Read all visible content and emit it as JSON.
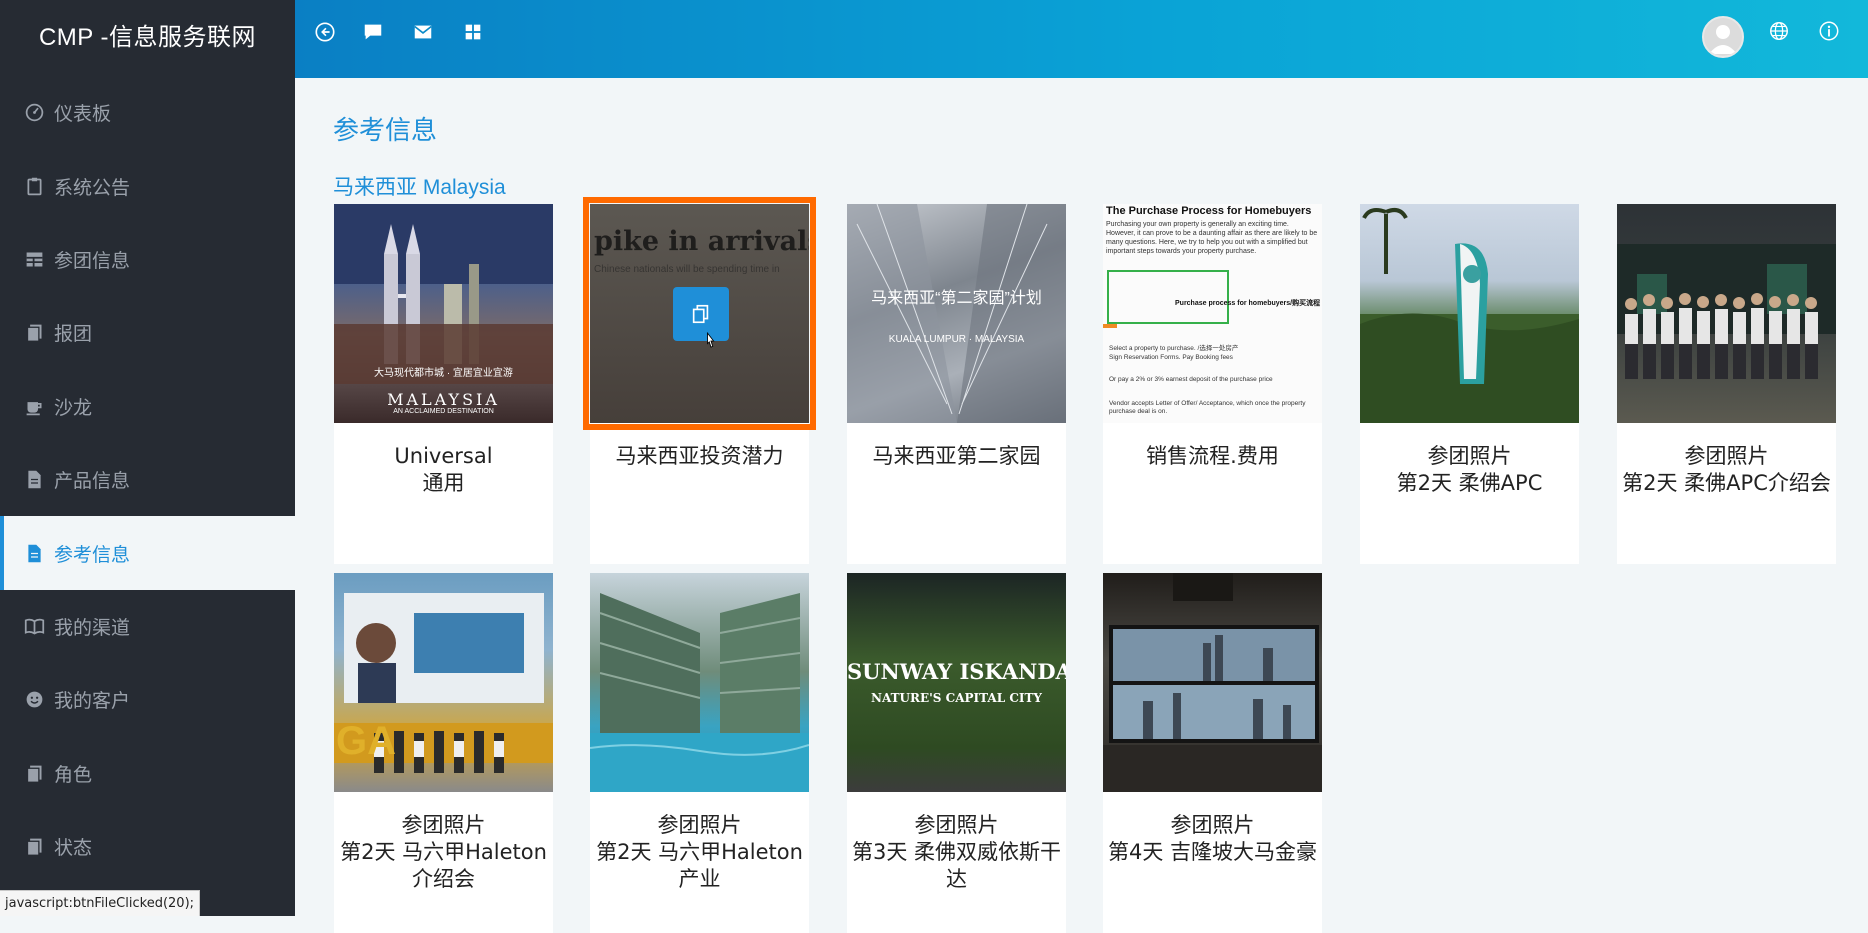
{
  "app": {
    "brand": "CMP -信息服务联网"
  },
  "sidebar": {
    "items": [
      {
        "label": "仪表板",
        "icon": "dashboard-icon"
      },
      {
        "label": "系统公告",
        "icon": "clipboard-icon"
      },
      {
        "label": "参团信息",
        "icon": "table-icon"
      },
      {
        "label": "报团",
        "icon": "documents-icon"
      },
      {
        "label": "沙龙",
        "icon": "coffee-icon"
      },
      {
        "label": "产品信息",
        "icon": "file-icon"
      },
      {
        "label": "参考信息",
        "icon": "file-icon",
        "active": true
      },
      {
        "label": "我的渠道",
        "icon": "book-icon"
      },
      {
        "label": "我的客户",
        "icon": "smile-icon"
      },
      {
        "label": "角色",
        "icon": "documents-icon"
      },
      {
        "label": "状态",
        "icon": "documents-icon"
      }
    ]
  },
  "header": {
    "icons": [
      "back-icon",
      "chat-icon",
      "mail-icon",
      "grid-icon",
      "avatar",
      "globe-icon",
      "info-icon"
    ]
  },
  "main": {
    "page_title": "参考信息",
    "section_title": "马来西亚 Malaysia",
    "cards": [
      {
        "lines": [
          "Universal",
          "通用"
        ],
        "thumb_text": [
          "大马现代都市城 · 宜居宜业宜游",
          "MALAYSIA",
          "AN ACCLAIMED DESTINATION"
        ]
      },
      {
        "lines": [
          "马来西亚投资潜力"
        ],
        "selected": true,
        "thumb_text": [
          "pike in arrivals fro",
          "Chinese nationals will be spending time in"
        ]
      },
      {
        "lines": [
          "马来西亚第二家园"
        ],
        "thumb_text": [
          "马来西亚“第二家园”计划",
          "KUALA LUMPUR · MALAYSIA"
        ]
      },
      {
        "lines": [
          "销售流程.费用"
        ],
        "thumb_text": [
          "The Purchase Process for Homebuyers",
          "Purchasing your own property is generally an exciting time. However, it can prove to be a daunting affair as there are likely to be many questions. Here, we try to help you out with a simplified but important steps towards your property purchase.",
          "Purchase process for homebuyers/购买流程",
          "Select a property to purchase. /选择一处房产",
          "Sign Reservation Forms. Pay Booking fees",
          "Or pay a 2% or 3% earnest deposit of the purchase price",
          "Vendor accepts Letter of Offer/ Acceptance, which once the property purchase deal is on."
        ]
      },
      {
        "lines": [
          "参团照片",
          "第2天 柔佛APC"
        ],
        "thumb_text": []
      },
      {
        "lines": [
          "参团照片",
          "第2天 柔佛APC介绍会"
        ],
        "thumb_text": []
      },
      {
        "lines": [
          "参团照片",
          "第2天 马六甲Haleton",
          "介绍会"
        ],
        "thumb_text": [
          "GA"
        ]
      },
      {
        "lines": [
          "参团照片",
          "第2天 马六甲Haleton",
          "产业"
        ],
        "thumb_text": []
      },
      {
        "lines": [
          "参团照片",
          "第3天 柔佛双威依斯干",
          "达"
        ],
        "thumb_text": [
          "SUNWAY ISKANDAR",
          "NATURE'S CAPITAL CITY"
        ]
      },
      {
        "lines": [
          "参团照片",
          "第4天 吉隆坡大马金豪"
        ],
        "thumb_text": []
      }
    ]
  },
  "status_bar": {
    "text": "javascript:btnFileClicked(20);"
  },
  "colors": {
    "accent": "#1f8fd8",
    "sidebar_bg": "#262b33",
    "selection": "#ff6a00"
  }
}
